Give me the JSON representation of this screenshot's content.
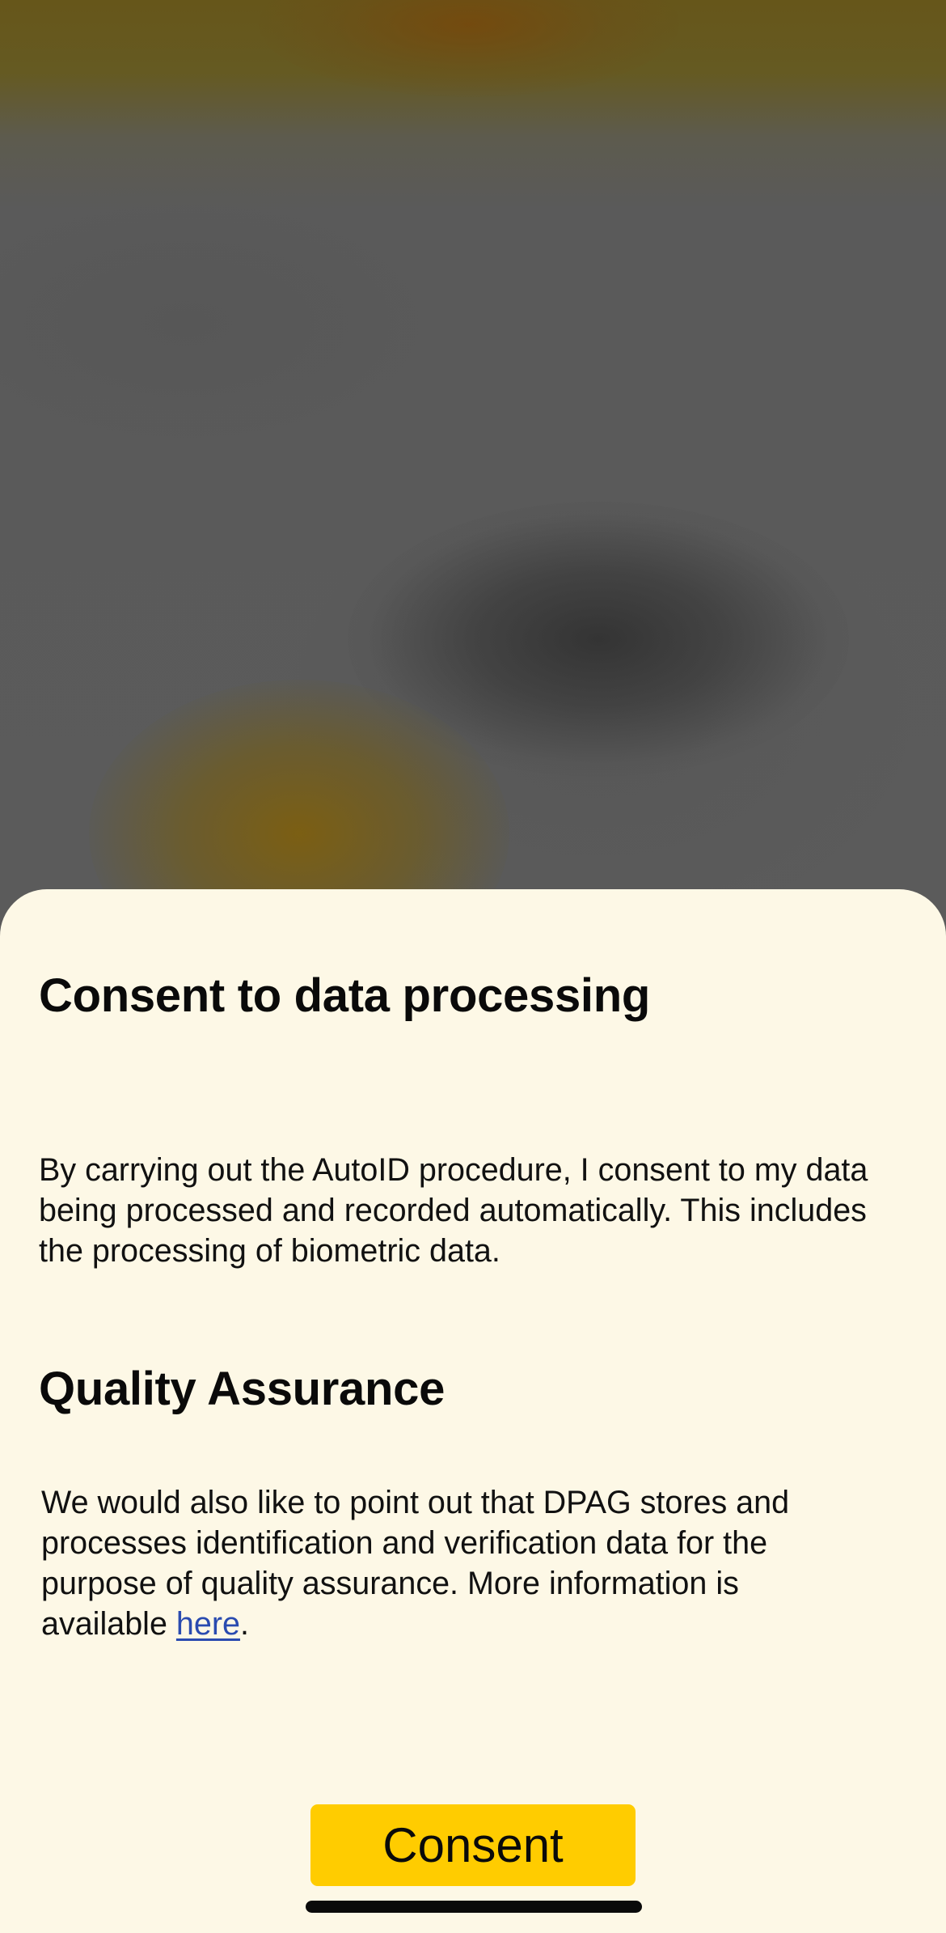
{
  "consent_section": {
    "title": "Consent to data processing",
    "body": "By carrying out the AutoID procedure, I consent to my data being processed and recorded automatically. This includes the processing of biometric data."
  },
  "quality_section": {
    "title": "Quality Assurance",
    "body_line1": "We would also like to point out that DPAG stores and",
    "body_line2": "processes identification and verification data for the",
    "body_line3": "purpose of quality assurance. More information is",
    "body_before_link": "available ",
    "link_label": "here",
    "body_after_link": "."
  },
  "actions": {
    "consent_label": "Consent"
  },
  "colors": {
    "sheet_background": "#fdf8e6",
    "button_yellow": "#ffcc00",
    "link_blue": "#2a4bb0",
    "backdrop_gray": "#5a5a5a"
  }
}
